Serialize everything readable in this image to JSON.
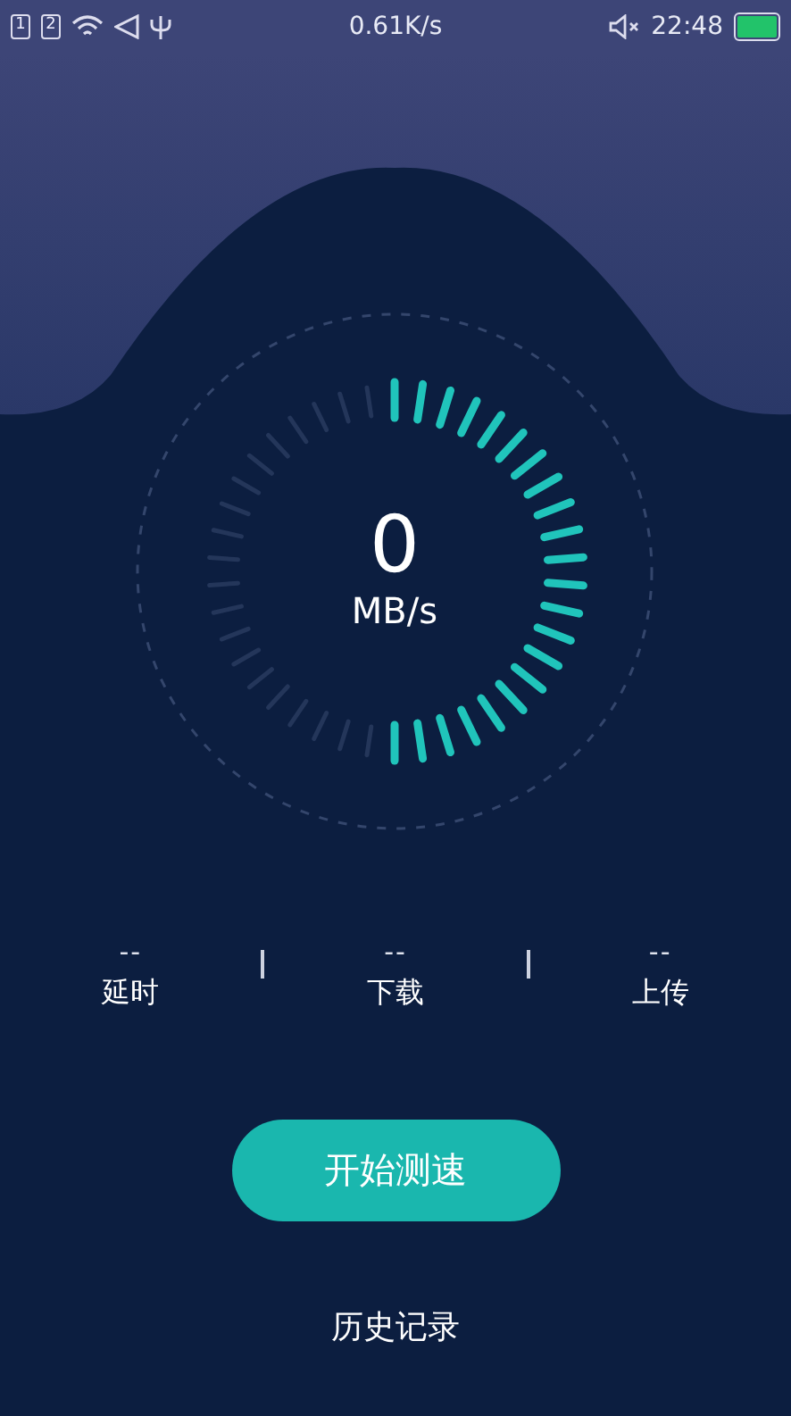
{
  "status_bar": {
    "sim_cards": [
      {
        "label": "1"
      },
      {
        "label": "2"
      }
    ],
    "speed": "0.61K/s",
    "time": "22:48"
  },
  "gauge": {
    "value": "0",
    "unit": "MB/s"
  },
  "stats": [
    {
      "value": "--",
      "label": "延时"
    },
    {
      "value": "--",
      "label": "下载"
    },
    {
      "value": "--",
      "label": "上传"
    }
  ],
  "start_button": "开始测速",
  "history_link": "历史记录"
}
